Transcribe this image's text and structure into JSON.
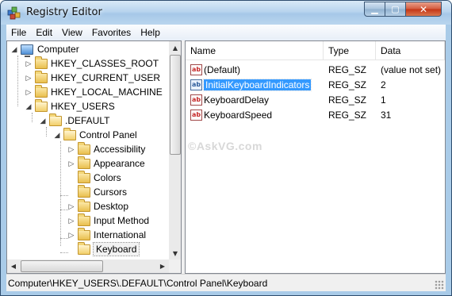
{
  "window": {
    "title": "Registry Editor",
    "icon": "registry-editor-icon",
    "controls": {
      "minimize": "▁",
      "maximize": "▢",
      "close": "✕"
    }
  },
  "menu": [
    {
      "key": "F",
      "rest": "ile"
    },
    {
      "key": "E",
      "rest": "dit"
    },
    {
      "key": "V",
      "rest": "iew"
    },
    {
      "key": "",
      "pre": "F",
      "ul": "a",
      "rest": "vorites"
    },
    {
      "key": "H",
      "rest": "elp"
    }
  ],
  "menu_labels": [
    "File",
    "Edit",
    "View",
    "Favorites",
    "Help"
  ],
  "tree": {
    "root": "Computer",
    "items": [
      {
        "label": "HKEY_CLASSES_ROOT",
        "expander": "▷",
        "open": false
      },
      {
        "label": "HKEY_CURRENT_USER",
        "expander": "▷",
        "open": false
      },
      {
        "label": "HKEY_LOCAL_MACHINE",
        "expander": "▷",
        "open": false
      },
      {
        "label": "HKEY_USERS",
        "expander": "◢",
        "open": true
      },
      {
        "label": ".DEFAULT",
        "expander": "◢",
        "open": true
      },
      {
        "label": "Control Panel",
        "expander": "◢",
        "open": true
      },
      {
        "label": "Accessibility",
        "expander": "▷",
        "open": false
      },
      {
        "label": "Appearance",
        "expander": "▷",
        "open": false
      },
      {
        "label": "Colors",
        "expander": "",
        "open": false
      },
      {
        "label": "Cursors",
        "expander": "",
        "open": false
      },
      {
        "label": "Desktop",
        "expander": "▷",
        "open": false
      },
      {
        "label": "Input Method",
        "expander": "▷",
        "open": false
      },
      {
        "label": "International",
        "expander": "▷",
        "open": false
      },
      {
        "label": "Keyboard",
        "expander": "",
        "open": true,
        "selected": true
      }
    ]
  },
  "list": {
    "columns": {
      "name": "Name",
      "type": "Type",
      "data": "Data"
    },
    "rows": [
      {
        "name": "(Default)",
        "type": "REG_SZ",
        "data": "(value not set)",
        "selected": false
      },
      {
        "name": "InitialKeyboardIndicators",
        "type": "REG_SZ",
        "data": "2",
        "selected": true
      },
      {
        "name": "KeyboardDelay",
        "type": "REG_SZ",
        "data": "1",
        "selected": false
      },
      {
        "name": "KeyboardSpeed",
        "type": "REG_SZ",
        "data": "31",
        "selected": false
      }
    ]
  },
  "watermark": "©AskVG.com",
  "status": "Computer\\HKEY_USERS\\.DEFAULT\\Control Panel\\Keyboard",
  "colors": {
    "selection": "#3399ff",
    "frame": "#a9cbe8",
    "close_button": "#c43314",
    "folder": "#e9bf4e"
  }
}
